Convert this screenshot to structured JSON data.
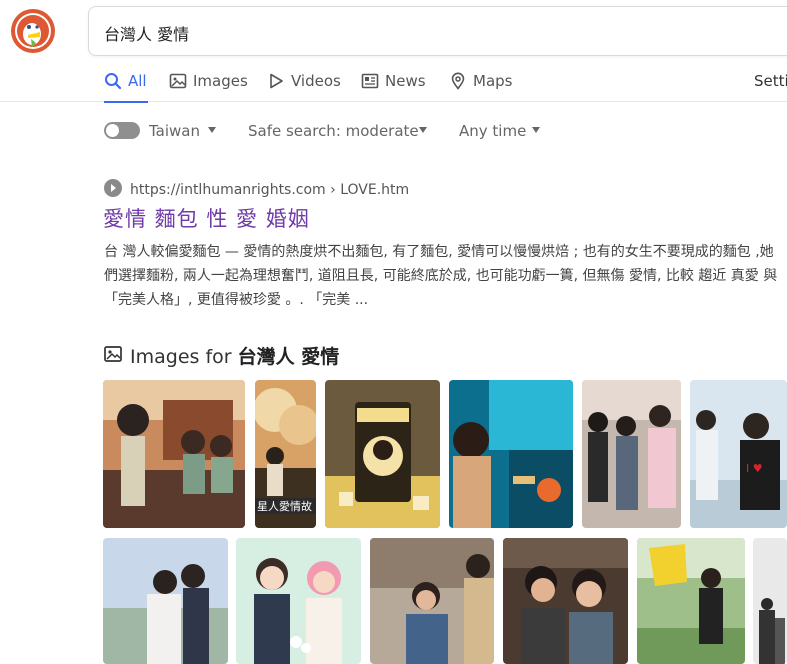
{
  "search": {
    "query": "台灣人 愛情"
  },
  "tabs": [
    {
      "label": "All",
      "icon": "search-icon",
      "active": true
    },
    {
      "label": "Images",
      "icon": "image-icon",
      "active": false
    },
    {
      "label": "Videos",
      "icon": "play-icon",
      "active": false
    },
    {
      "label": "News",
      "icon": "newspaper-icon",
      "active": false
    },
    {
      "label": "Maps",
      "icon": "map-pin-icon",
      "active": false
    }
  ],
  "settings_label": "Setti",
  "filters": {
    "region": "Taiwan",
    "safe_search": "Safe search: moderate",
    "time": "Any time"
  },
  "result": {
    "domain": "https://intlhumanrights.com",
    "path": " › LOVE.htm",
    "title": "愛情 麵包 性 愛 婚姻",
    "snippet": "台 灣人較偏愛麵包 — 愛情的熱度烘不出麵包, 有了麵包, 愛情可以慢慢烘焙 ; 也有的女生不要現成的麵包 ,她們選擇麵粉, 兩人一起為理想奮鬥, 道阻且長, 可能終底於成, 也可能功虧一簣, 但無傷 愛情, 比較 趨近 真愛 與「完美人格」, 更值得被珍愛 。. 「完美 ..."
  },
  "images_module": {
    "prefix": "Images for ",
    "query": "台灣人 愛情",
    "thumb_text": "星人愛情故"
  },
  "colors": {
    "accent": "#3969ef",
    "visited_title": "#6f3ba7",
    "logo_orange": "#de5833"
  }
}
